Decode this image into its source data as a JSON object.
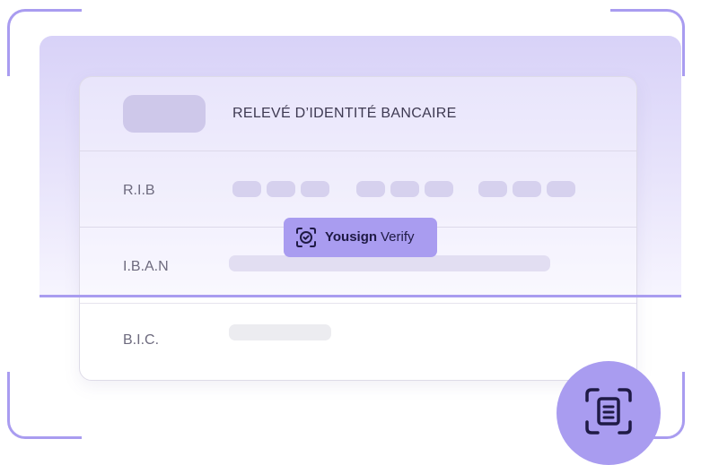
{
  "document": {
    "title": "RELEVÉ D’IDENTITÉ BANCAIRE",
    "rows": [
      {
        "label": "R.I.B"
      },
      {
        "label": "I.B.A.N"
      },
      {
        "label": "B.I.C."
      }
    ]
  },
  "badge": {
    "brand": "Yousign",
    "product": "Verify",
    "icon": "scan-check-icon"
  },
  "action_button": {
    "icon": "document-scan-icon"
  },
  "colors": {
    "accent": "#a99cf0",
    "band_top": "#d8d2f8",
    "text_dark": "#1f1a45",
    "text_label": "#6d6a7e"
  }
}
